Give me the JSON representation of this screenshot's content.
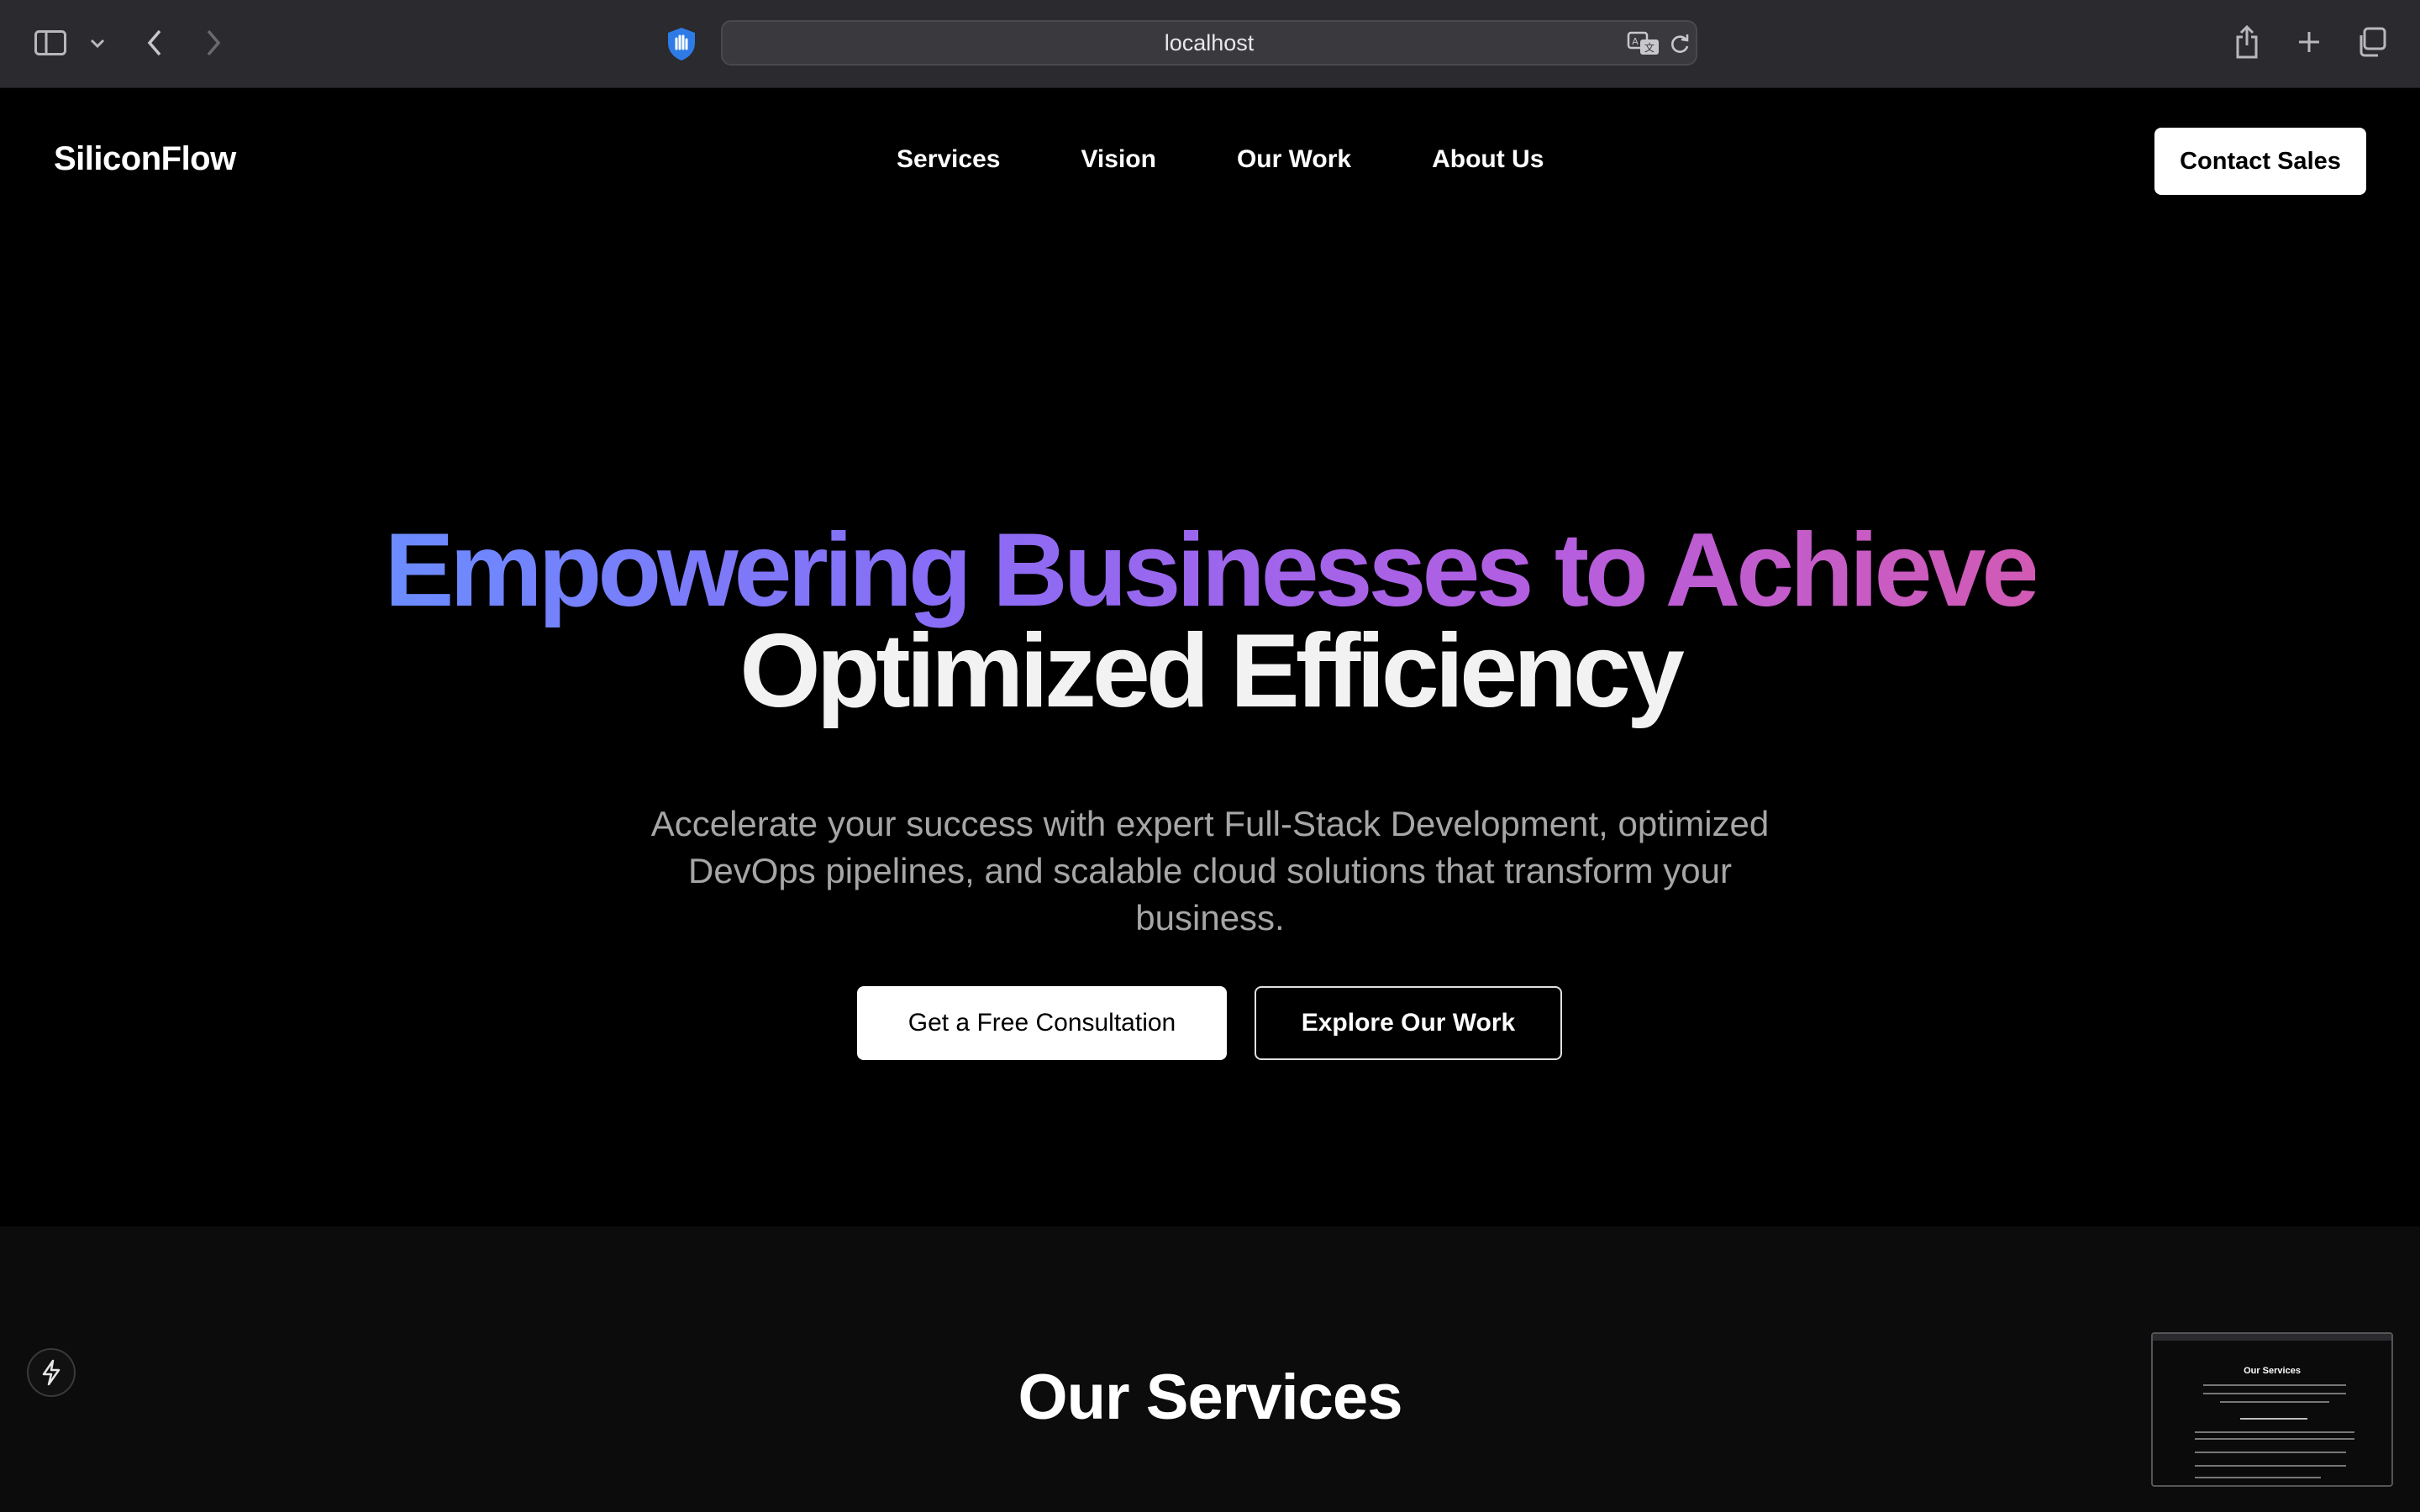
{
  "browser": {
    "url": "localhost"
  },
  "nav": {
    "logo": "SiliconFlow",
    "links": [
      "Services",
      "Vision",
      "Our Work",
      "About Us"
    ],
    "cta": "Contact Sales"
  },
  "hero": {
    "headline_line1": "Empowering Businesses to Achieve",
    "headline_line2": "Optimized Efficiency",
    "subtext": "Accelerate your success with expert Full-Stack Development, optimized DevOps pipelines, and scalable cloud solutions that transform your business.",
    "primary_button": "Get a Free Consultation",
    "secondary_button": "Explore Our Work"
  },
  "services": {
    "title": "Our Services"
  },
  "colors": {
    "gradient_start": "#6b8cff",
    "gradient_end": "#d25ab4",
    "background": "#000000",
    "section_background": "#0c0c0c"
  }
}
